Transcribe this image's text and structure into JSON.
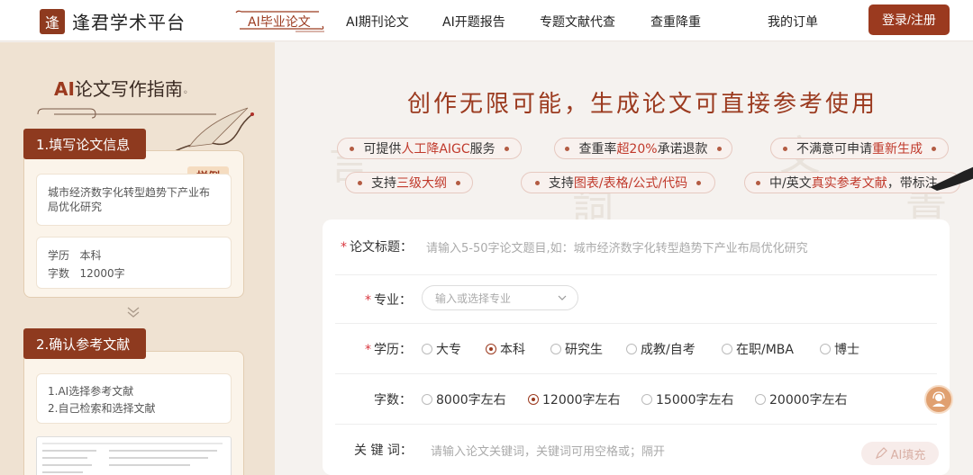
{
  "brand": {
    "logo_glyph": "逢",
    "name": "逢君学术平台"
  },
  "nav": {
    "items": [
      {
        "label": "AI毕业论文",
        "active": true
      },
      {
        "label": "AI期刊论文"
      },
      {
        "label": "AI开题报告"
      },
      {
        "label": "专题文献代查"
      },
      {
        "label": "查重降重"
      },
      {
        "label": "我的订单"
      }
    ],
    "login": "登录/注册"
  },
  "guide": {
    "title_ai": "AI",
    "title_rest": "论文写作指南",
    "step1": {
      "label": "1.填写论文信息",
      "sample_tag": "样例",
      "topic": "城市经济数字化转型趋势下产业布局优化研究",
      "degree_label": "学历",
      "degree_value": "本科",
      "words_label": "字数",
      "words_value": "12000字"
    },
    "step2": {
      "label": "2.确认参考文献",
      "line1": "1.AI选择参考文献",
      "line2": "2.自己检索和选择文献"
    }
  },
  "main": {
    "headline": "创作无限可能，生成论文可直接参考使用",
    "features": [
      {
        "pre": "可提供",
        "hl": "人工降AIGC",
        "post": "服务"
      },
      {
        "pre": "查重率",
        "hl": "超20%",
        "post": "承诺退款"
      },
      {
        "pre": "不满意可申请",
        "hl": "重新生成",
        "post": ""
      },
      {
        "pre": "支持",
        "hl": "三级大纲",
        "post": ""
      },
      {
        "pre": "支持",
        "hl": "图表/表格/公式/代码",
        "post": ""
      },
      {
        "pre": "中/英文",
        "hl": "真实参考文献",
        "post": "，带标注"
      }
    ],
    "form": {
      "title_label": "论文标题：",
      "title_placeholder": "请输入5-50字论文题目,如：城市经济数字化转型趋势下产业布局优化研究",
      "major_label": "专业：",
      "major_placeholder": "输入或选择专业",
      "degree_label": "学历：",
      "degree_options": [
        "大专",
        "本科",
        "研究生",
        "成教/自考",
        "在职/MBA",
        "博士"
      ],
      "degree_selected": "本科",
      "words_label": "字数：",
      "words_options": [
        "8000字左右",
        "12000字左右",
        "15000字左右",
        "20000字左右"
      ],
      "words_selected": "12000字左右",
      "keywords_label": "关 键 词：",
      "keywords_placeholder": "请输入论文关键词，关键词可用空格或；隔开",
      "ai_fill": "AI填充"
    }
  }
}
